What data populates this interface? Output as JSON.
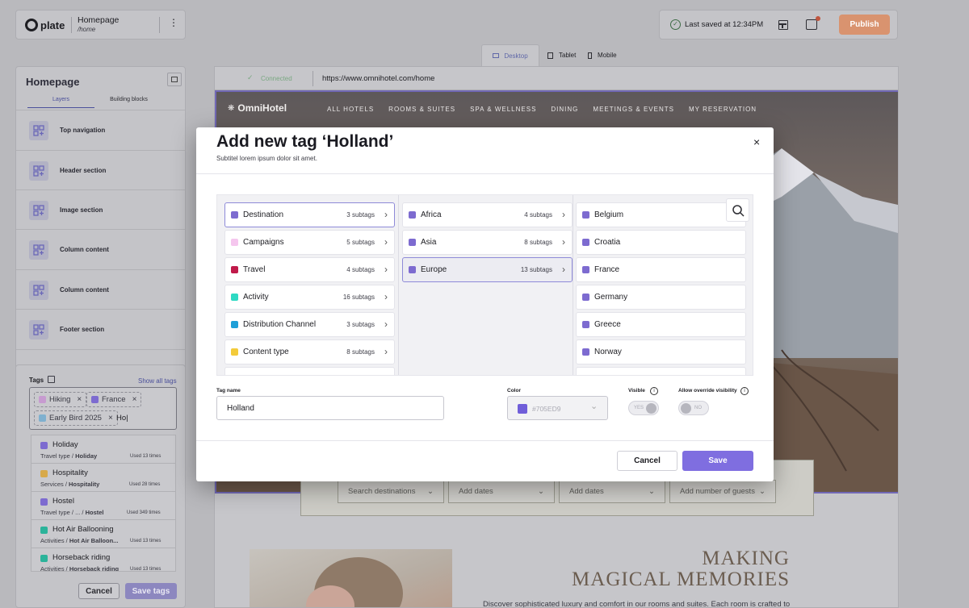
{
  "header": {
    "brand": "plate",
    "page_title": "Homepage",
    "page_path": "/home",
    "save_status": "Last saved at 12:34PM",
    "publish_label": "Publish"
  },
  "devices": [
    {
      "label": "Desktop",
      "icon": "desktop-icon"
    },
    {
      "label": "Tablet",
      "icon": "tablet-icon"
    },
    {
      "label": "Mobile",
      "icon": "mobile-icon"
    }
  ],
  "sidebar": {
    "title": "Homepage",
    "tabs": [
      "Layers",
      "Building blocks"
    ],
    "layers": [
      "Top navigation",
      "Header section",
      "Image section",
      "Column content",
      "Column content",
      "Footer section"
    ]
  },
  "tags_panel": {
    "title": "Tags",
    "show_all": "Show all tags",
    "chips": [
      {
        "label": "Hiking",
        "color": "#c79bd0"
      },
      {
        "label": "France",
        "color": "#7d6bd0"
      },
      {
        "label": "Early Bird 2025",
        "color": "#7fb0cf"
      }
    ],
    "input_value": "Ho|",
    "suggestions": [
      {
        "name": "Holiday",
        "path_prefix": "Travel type / ",
        "path_tail": "Holiday",
        "used": "Used 13 times",
        "color": "#7d6bd0"
      },
      {
        "name": "Hospitality",
        "path_prefix": "Services / ",
        "path_tail": "Hospitality",
        "used": "Used 28 times",
        "color": "#d7a94a"
      },
      {
        "name": "Hostel",
        "path_prefix": "Travel type / ... / ",
        "path_tail": "Hostel",
        "used": "Used 349 times",
        "color": "#7d6bd0"
      },
      {
        "name": "Hot Air Ballooning",
        "path_prefix": "Activities / ",
        "path_tail": "Hot Air Balloon...",
        "used": "Used 13 times",
        "color": "#2bb39a"
      },
      {
        "name": "Horseback riding",
        "path_prefix": "Activities / ",
        "path_tail": "Horseback riding",
        "used": "Used 13 times",
        "color": "#2bb39a"
      }
    ],
    "cancel_label": "Cancel",
    "save_label": "Save tags"
  },
  "preview": {
    "connection": "Connected",
    "url": "https://www.omnihotel.com/home",
    "hotel_brand": "OmniHotel",
    "nav": [
      "ALL HOTELS",
      "ROOMS & SUITES",
      "SPA & WELLNESS",
      "DINING",
      "MEETINGS & EVENTS",
      "MY RESERVATION"
    ],
    "search_fields": [
      "Search destinations",
      "Add dates",
      "Add dates",
      "Add number of guests"
    ],
    "headline_1": "MAKING",
    "headline_2": "MAGICAL MEMORIES",
    "body": "Discover sophisticated luxury and comfort in our rooms and suites. Each room is crafted to"
  },
  "modal": {
    "title": "Add new tag ‘Holland’",
    "subtitle": "Subtitel lorem ipsum dolor sit amet.",
    "col1": [
      {
        "label": "Destination",
        "subtags": "3 subtags",
        "color": "#7d6bd0"
      },
      {
        "label": "Campaigns",
        "subtags": "5 subtags",
        "color": "#f5c6ee"
      },
      {
        "label": "Travel",
        "subtags": "4 subtags",
        "color": "#c01a4a"
      },
      {
        "label": "Activity",
        "subtags": "16 subtags",
        "color": "#2ed9c3"
      },
      {
        "label": "Distribution Channel",
        "subtags": "3 subtags",
        "color": "#1e9fd8"
      },
      {
        "label": "Content type",
        "subtags": "8 subtags",
        "color": "#f3cb3a"
      }
    ],
    "col2": [
      {
        "label": "Africa",
        "subtags": "4 subtags",
        "color": "#7d6bd0"
      },
      {
        "label": "Asia",
        "subtags": "8 subtags",
        "color": "#7d6bd0"
      },
      {
        "label": "Europe",
        "subtags": "13 subtags",
        "color": "#7d6bd0"
      }
    ],
    "col3": [
      {
        "label": "Belgium",
        "color": "#7d6bd0"
      },
      {
        "label": "Croatia",
        "color": "#7d6bd0"
      },
      {
        "label": "France",
        "color": "#7d6bd0"
      },
      {
        "label": "Germany",
        "color": "#7d6bd0"
      },
      {
        "label": "Greece",
        "color": "#7d6bd0"
      },
      {
        "label": "Norway",
        "color": "#7d6bd0"
      }
    ],
    "tag_name_label": "Tag name",
    "tag_name_value": "Holland",
    "color_label": "Color",
    "color_value": "#705ED9",
    "visible_label": "Visible",
    "visible_value": "YES",
    "override_label": "Allow override visibility",
    "override_value": "NO",
    "cancel_label": "Cancel",
    "save_label": "Save"
  }
}
